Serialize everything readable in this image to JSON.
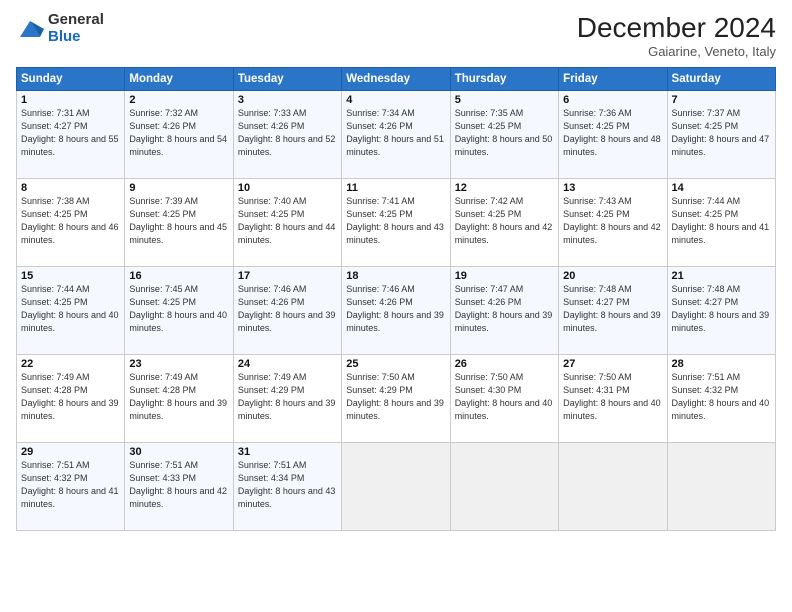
{
  "logo": {
    "general": "General",
    "blue": "Blue"
  },
  "header": {
    "month": "December 2024",
    "location": "Gaiarine, Veneto, Italy"
  },
  "days_of_week": [
    "Sunday",
    "Monday",
    "Tuesday",
    "Wednesday",
    "Thursday",
    "Friday",
    "Saturday"
  ],
  "weeks": [
    [
      {
        "day": 1,
        "sunrise": "Sunrise: 7:31 AM",
        "sunset": "Sunset: 4:27 PM",
        "daylight": "Daylight: 8 hours and 55 minutes."
      },
      {
        "day": 2,
        "sunrise": "Sunrise: 7:32 AM",
        "sunset": "Sunset: 4:26 PM",
        "daylight": "Daylight: 8 hours and 54 minutes."
      },
      {
        "day": 3,
        "sunrise": "Sunrise: 7:33 AM",
        "sunset": "Sunset: 4:26 PM",
        "daylight": "Daylight: 8 hours and 52 minutes."
      },
      {
        "day": 4,
        "sunrise": "Sunrise: 7:34 AM",
        "sunset": "Sunset: 4:26 PM",
        "daylight": "Daylight: 8 hours and 51 minutes."
      },
      {
        "day": 5,
        "sunrise": "Sunrise: 7:35 AM",
        "sunset": "Sunset: 4:25 PM",
        "daylight": "Daylight: 8 hours and 50 minutes."
      },
      {
        "day": 6,
        "sunrise": "Sunrise: 7:36 AM",
        "sunset": "Sunset: 4:25 PM",
        "daylight": "Daylight: 8 hours and 48 minutes."
      },
      {
        "day": 7,
        "sunrise": "Sunrise: 7:37 AM",
        "sunset": "Sunset: 4:25 PM",
        "daylight": "Daylight: 8 hours and 47 minutes."
      }
    ],
    [
      {
        "day": 8,
        "sunrise": "Sunrise: 7:38 AM",
        "sunset": "Sunset: 4:25 PM",
        "daylight": "Daylight: 8 hours and 46 minutes."
      },
      {
        "day": 9,
        "sunrise": "Sunrise: 7:39 AM",
        "sunset": "Sunset: 4:25 PM",
        "daylight": "Daylight: 8 hours and 45 minutes."
      },
      {
        "day": 10,
        "sunrise": "Sunrise: 7:40 AM",
        "sunset": "Sunset: 4:25 PM",
        "daylight": "Daylight: 8 hours and 44 minutes."
      },
      {
        "day": 11,
        "sunrise": "Sunrise: 7:41 AM",
        "sunset": "Sunset: 4:25 PM",
        "daylight": "Daylight: 8 hours and 43 minutes."
      },
      {
        "day": 12,
        "sunrise": "Sunrise: 7:42 AM",
        "sunset": "Sunset: 4:25 PM",
        "daylight": "Daylight: 8 hours and 42 minutes."
      },
      {
        "day": 13,
        "sunrise": "Sunrise: 7:43 AM",
        "sunset": "Sunset: 4:25 PM",
        "daylight": "Daylight: 8 hours and 42 minutes."
      },
      {
        "day": 14,
        "sunrise": "Sunrise: 7:44 AM",
        "sunset": "Sunset: 4:25 PM",
        "daylight": "Daylight: 8 hours and 41 minutes."
      }
    ],
    [
      {
        "day": 15,
        "sunrise": "Sunrise: 7:44 AM",
        "sunset": "Sunset: 4:25 PM",
        "daylight": "Daylight: 8 hours and 40 minutes."
      },
      {
        "day": 16,
        "sunrise": "Sunrise: 7:45 AM",
        "sunset": "Sunset: 4:25 PM",
        "daylight": "Daylight: 8 hours and 40 minutes."
      },
      {
        "day": 17,
        "sunrise": "Sunrise: 7:46 AM",
        "sunset": "Sunset: 4:26 PM",
        "daylight": "Daylight: 8 hours and 39 minutes."
      },
      {
        "day": 18,
        "sunrise": "Sunrise: 7:46 AM",
        "sunset": "Sunset: 4:26 PM",
        "daylight": "Daylight: 8 hours and 39 minutes."
      },
      {
        "day": 19,
        "sunrise": "Sunrise: 7:47 AM",
        "sunset": "Sunset: 4:26 PM",
        "daylight": "Daylight: 8 hours and 39 minutes."
      },
      {
        "day": 20,
        "sunrise": "Sunrise: 7:48 AM",
        "sunset": "Sunset: 4:27 PM",
        "daylight": "Daylight: 8 hours and 39 minutes."
      },
      {
        "day": 21,
        "sunrise": "Sunrise: 7:48 AM",
        "sunset": "Sunset: 4:27 PM",
        "daylight": "Daylight: 8 hours and 39 minutes."
      }
    ],
    [
      {
        "day": 22,
        "sunrise": "Sunrise: 7:49 AM",
        "sunset": "Sunset: 4:28 PM",
        "daylight": "Daylight: 8 hours and 39 minutes."
      },
      {
        "day": 23,
        "sunrise": "Sunrise: 7:49 AM",
        "sunset": "Sunset: 4:28 PM",
        "daylight": "Daylight: 8 hours and 39 minutes."
      },
      {
        "day": 24,
        "sunrise": "Sunrise: 7:49 AM",
        "sunset": "Sunset: 4:29 PM",
        "daylight": "Daylight: 8 hours and 39 minutes."
      },
      {
        "day": 25,
        "sunrise": "Sunrise: 7:50 AM",
        "sunset": "Sunset: 4:29 PM",
        "daylight": "Daylight: 8 hours and 39 minutes."
      },
      {
        "day": 26,
        "sunrise": "Sunrise: 7:50 AM",
        "sunset": "Sunset: 4:30 PM",
        "daylight": "Daylight: 8 hours and 40 minutes."
      },
      {
        "day": 27,
        "sunrise": "Sunrise: 7:50 AM",
        "sunset": "Sunset: 4:31 PM",
        "daylight": "Daylight: 8 hours and 40 minutes."
      },
      {
        "day": 28,
        "sunrise": "Sunrise: 7:51 AM",
        "sunset": "Sunset: 4:32 PM",
        "daylight": "Daylight: 8 hours and 40 minutes."
      }
    ],
    [
      {
        "day": 29,
        "sunrise": "Sunrise: 7:51 AM",
        "sunset": "Sunset: 4:32 PM",
        "daylight": "Daylight: 8 hours and 41 minutes."
      },
      {
        "day": 30,
        "sunrise": "Sunrise: 7:51 AM",
        "sunset": "Sunset: 4:33 PM",
        "daylight": "Daylight: 8 hours and 42 minutes."
      },
      {
        "day": 31,
        "sunrise": "Sunrise: 7:51 AM",
        "sunset": "Sunset: 4:34 PM",
        "daylight": "Daylight: 8 hours and 43 minutes."
      },
      null,
      null,
      null,
      null
    ]
  ]
}
